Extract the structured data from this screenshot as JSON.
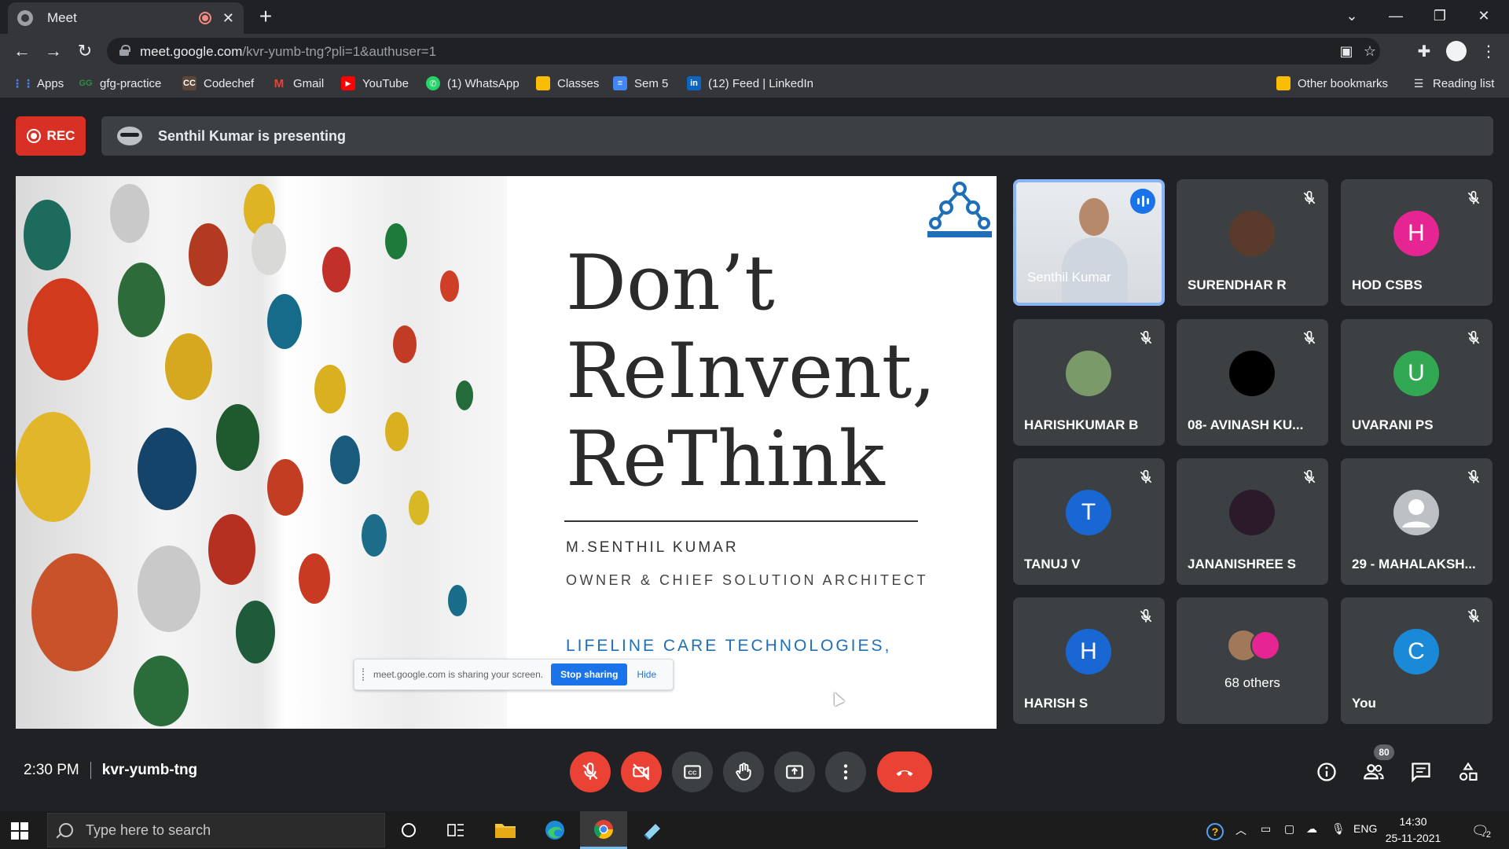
{
  "browser": {
    "tab_title": "Meet",
    "url_host": "meet.google.com",
    "url_path": "/kvr-yumb-tng?pli=1&authuser=1"
  },
  "bookmarks": [
    {
      "label": "Apps",
      "icon": "apps-grid-icon",
      "color": "#4285f4"
    },
    {
      "label": "gfg-practice",
      "icon": "gfg-icon",
      "color": "#2f8d46"
    },
    {
      "label": "Codechef",
      "icon": "codechef-icon",
      "color": "#5b4638"
    },
    {
      "label": "Gmail",
      "icon": "gmail-icon",
      "color": "#ea4335"
    },
    {
      "label": "YouTube",
      "icon": "youtube-icon",
      "color": "#ff0000"
    },
    {
      "label": "(1) WhatsApp",
      "icon": "whatsapp-icon",
      "color": "#25d366"
    },
    {
      "label": "Classes",
      "icon": "classroom-icon",
      "color": "#fbbc04"
    },
    {
      "label": "Sem 5",
      "icon": "docs-icon",
      "color": "#4285f4"
    },
    {
      "label": "(12) Feed | LinkedIn",
      "icon": "linkedin-icon",
      "color": "#0a66c2"
    }
  ],
  "bookmarks_right": {
    "other": "Other bookmarks",
    "reading": "Reading list"
  },
  "meet": {
    "rec_label": "REC",
    "presenting_text": "Senthil Kumar is presenting",
    "time": "2:30 PM",
    "meeting_code": "kvr-yumb-tng",
    "participant_count": "80"
  },
  "slide": {
    "title": "Don’t\nReInvent,\nReThink",
    "name": "M.SENTHIL KUMAR",
    "role": "OWNER & CHIEF SOLUTION ARCHITECT",
    "company": "LIFELINE CARE TECHNOLOGIES,",
    "logo_caption": "Lifeline Care Technologies"
  },
  "share_bar": {
    "text": "meet.google.com is sharing your screen.",
    "stop": "Stop sharing",
    "hide": "Hide"
  },
  "tiles": [
    {
      "name": "Senthil Kumar",
      "type": "video",
      "speaking": true
    },
    {
      "name": "SURENDHAR R",
      "type": "photo",
      "avatar_color": "#5a3a2a"
    },
    {
      "name": "HOD CSBS",
      "type": "initial",
      "initial": "H",
      "avatar_color": "#e52592"
    },
    {
      "name": "HARISHKUMAR B",
      "type": "photo",
      "avatar_color": "#7a9a6a"
    },
    {
      "name": "08- AVINASH KU...",
      "type": "photo",
      "avatar_color": "#000000"
    },
    {
      "name": "UVARANI PS",
      "type": "initial",
      "initial": "U",
      "avatar_color": "#33a853"
    },
    {
      "name": "TANUJ V",
      "type": "initial",
      "initial": "T",
      "avatar_color": "#1967d2"
    },
    {
      "name": "JANANISHREE S",
      "type": "photo",
      "avatar_color": "#2a1a2a"
    },
    {
      "name": "29 - MAHALAKSH...",
      "type": "default",
      "avatar_color": "#bdc1c6"
    },
    {
      "name": "HARISH S",
      "type": "initial",
      "initial": "H",
      "avatar_color": "#1967d2"
    },
    {
      "name": "68 others",
      "type": "others"
    },
    {
      "name": "You",
      "type": "initial",
      "initial": "C",
      "avatar_color": "#1a8ad8"
    }
  ],
  "taskbar": {
    "search_placeholder": "Type here to search",
    "lang": "ENG",
    "time": "14:30",
    "date": "25-11-2021",
    "notifications": "2"
  }
}
